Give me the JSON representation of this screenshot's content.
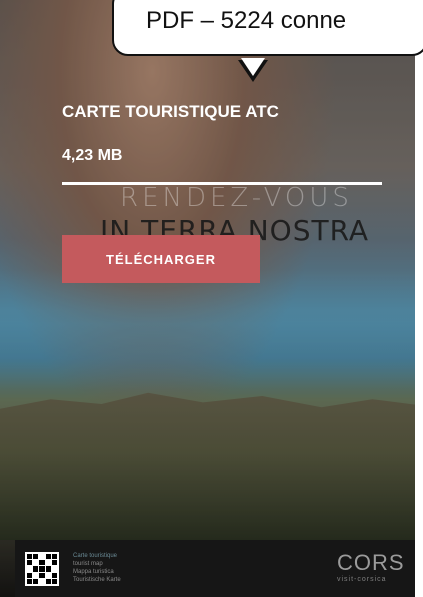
{
  "card": {
    "title": "CARTE TOURISTIQUE ATC",
    "size": "4,23 MB",
    "download_label": "TÉLÉCHARGER"
  },
  "image_text": {
    "tagline": "RENDEZ-VOUS",
    "brand_line": "IN TERRA NOSTRA"
  },
  "footer": {
    "lines": [
      "Carte touristique",
      "tourist map",
      "Mappa turistica",
      "Touristische Karte"
    ],
    "brand": "CORS",
    "brand_sub": "visit-corsica"
  },
  "tooltip": {
    "line1": "",
    "line2": "PDF – 5224 conne"
  },
  "colors": {
    "button": "#c45a5d",
    "tooltip_border": "#111111",
    "footer_bg": "#161616"
  }
}
